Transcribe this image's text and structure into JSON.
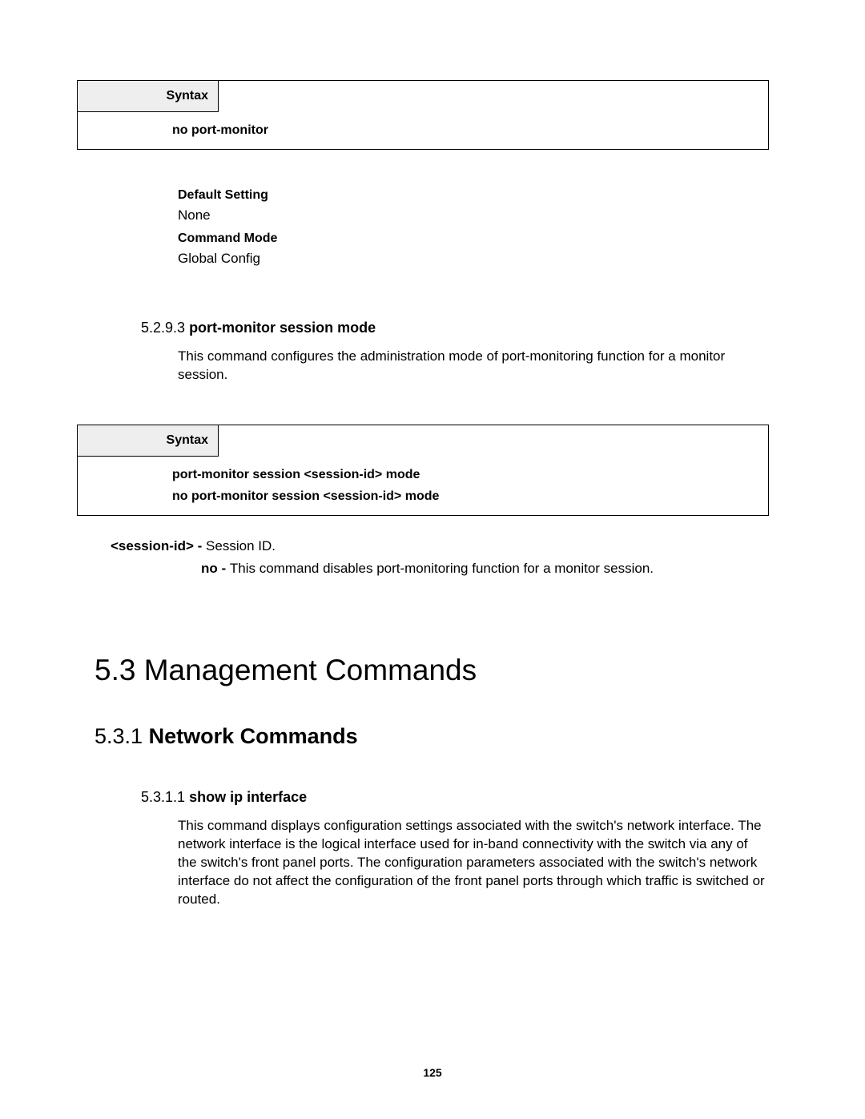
{
  "box1": {
    "header": "Syntax",
    "lines": [
      "no port-monitor"
    ]
  },
  "meta1": {
    "default_label": "Default Setting",
    "default_value": "None",
    "mode_label": "Command Mode",
    "mode_value": "Global Config"
  },
  "sub1": {
    "num": "5.2.9.3",
    "title": "port-monitor session mode",
    "para": "This command configures the administration mode of port-monitoring function for a monitor session."
  },
  "box2": {
    "header": "Syntax",
    "lines": [
      "port-monitor session <session-id> mode",
      "no port-monitor session <session-id> mode"
    ]
  },
  "params": {
    "session_term": "<session-id> - ",
    "session_desc": "Session ID.",
    "no_term": "no - ",
    "no_desc": "This command disables port-monitoring function for a monitor session."
  },
  "h1": "5.3 Management Commands",
  "h2": {
    "num": "5.3.1",
    "title": "Network Commands"
  },
  "sub2": {
    "num": "5.3.1.1",
    "title": "show ip interface",
    "para": "This command displays configuration settings associated with the switch's network interface. The network interface is the logical interface used for in-band connectivity with the switch via any of the switch's front panel ports. The configuration parameters associated with the switch's network interface do not affect the configuration of the front panel ports through which traffic is switched or routed."
  },
  "page_num": "125"
}
